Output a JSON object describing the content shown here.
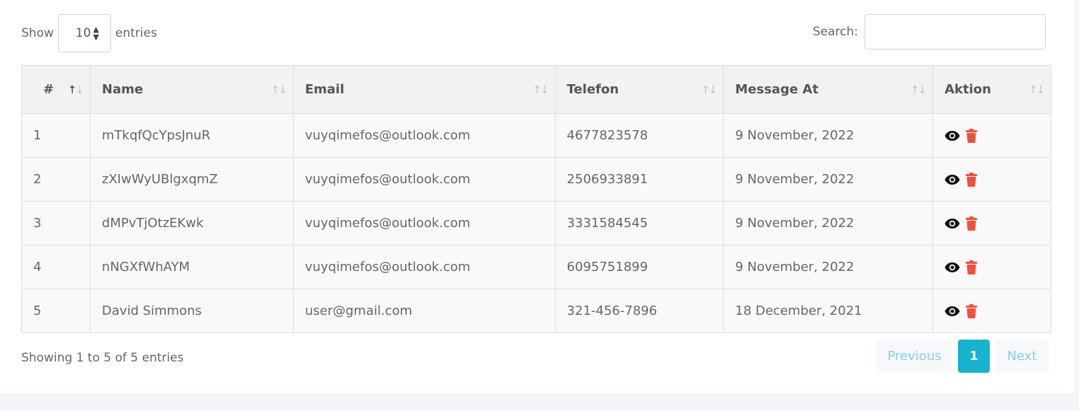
{
  "length_control": {
    "show_label": "Show",
    "value": "10",
    "entries_label": "entries"
  },
  "search": {
    "label": "Search:",
    "value": ""
  },
  "table": {
    "headers": {
      "num": "#",
      "name": "Name",
      "email": "Email",
      "phone": "Telefon",
      "message_at": "Message At",
      "action": "Aktion"
    },
    "rows": [
      {
        "num": "1",
        "name": "mTkqfQcYpsJnuR",
        "email": "vuyqimefos@outlook.com",
        "phone": "4677823578",
        "message_at": "9 November, 2022"
      },
      {
        "num": "2",
        "name": "zXIwWyUBlgxqmZ",
        "email": "vuyqimefos@outlook.com",
        "phone": "2506933891",
        "message_at": "9 November, 2022"
      },
      {
        "num": "3",
        "name": "dMPvTjOtzEKwk",
        "email": "vuyqimefos@outlook.com",
        "phone": "3331584545",
        "message_at": "9 November, 2022"
      },
      {
        "num": "4",
        "name": "nNGXfWhAYM",
        "email": "vuyqimefos@outlook.com",
        "phone": "6095751899",
        "message_at": "9 November, 2022"
      },
      {
        "num": "5",
        "name": "David Simmons",
        "email": "user@gmail.com",
        "phone": "321-456-7896",
        "message_at": "18 December, 2021"
      }
    ],
    "action_icons": [
      "eye-icon",
      "trash-icon"
    ]
  },
  "footer": {
    "info": "Showing 1 to 5 of 5 entries",
    "previous": "Previous",
    "current_page": "1",
    "next": "Next"
  },
  "colors": {
    "page_bg": "#f4f5f9",
    "trash": "#f0503c",
    "pager_active": "#17b4cf",
    "pager_text": "#7fd4e0"
  }
}
